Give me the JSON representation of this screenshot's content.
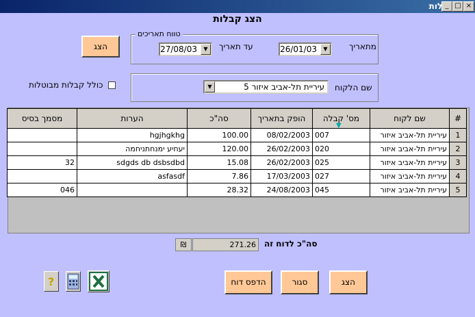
{
  "window": {
    "title": "דוח קבלות",
    "minimize": "_",
    "maximize": "□",
    "close": "×"
  },
  "heading": "הצג קבלות",
  "date_range": {
    "legend": "טווח תאריכים",
    "from_label": "מתאריך",
    "from_value": "26/01/03",
    "to_label": "עד תאריך",
    "to_value": "27/08/03"
  },
  "show_button_top": "הצג",
  "customer": {
    "label": "שם הלקוח",
    "value": "עיריית תל-אביב  איזור 5"
  },
  "include_cancelled": {
    "label": "כולל קבלות מבוטלות",
    "checked": false
  },
  "table": {
    "headers": {
      "rownum": "#",
      "customer_name": "שם לקוח",
      "receipt_no": "מס' קבלה",
      "issued_date": "הופק בתאריך",
      "total": "סה\"כ",
      "notes": "הערות",
      "base_doc": "מסמך בסיס"
    },
    "rows": [
      {
        "n": "1",
        "customer_name": "עיריית תל-אביב  איזור",
        "receipt_no": "007",
        "issued_date": "08/02/2003",
        "total": "100.00",
        "notes": "hgjhgkhg",
        "base_doc": ""
      },
      {
        "n": "2",
        "customer_name": "עיריית תל-אביב  איזור",
        "receipt_no": "020",
        "issued_date": "26/02/2003",
        "total": "120.00",
        "notes": "יעחיע ימנחתניחמה",
        "base_doc": ""
      },
      {
        "n": "3",
        "customer_name": "עיריית תל-אביב  איזור",
        "receipt_no": "025",
        "issued_date": "26/02/2003",
        "total": "15.08",
        "notes": "sdgds db dsbsdbd",
        "base_doc": "32"
      },
      {
        "n": "4",
        "customer_name": "עיריית תל-אביב  איזור",
        "receipt_no": "027",
        "issued_date": "17/03/2003",
        "total": "7.86",
        "notes": "asfasdf",
        "base_doc": ""
      },
      {
        "n": "5",
        "customer_name": "עיריית תל-אביב  איזור",
        "receipt_no": "045",
        "issued_date": "24/08/2003",
        "total": "28.32",
        "notes": "",
        "base_doc": "046"
      }
    ]
  },
  "report_total": {
    "label": "סה\"כ לדוח זה",
    "value": "271.26",
    "currency": "₪"
  },
  "buttons": {
    "show": "הצג",
    "close": "סגור",
    "print": "הדפס דוח"
  },
  "icons": {
    "help": "help-icon",
    "calculator": "calculator-icon",
    "excel": "excel-icon"
  }
}
